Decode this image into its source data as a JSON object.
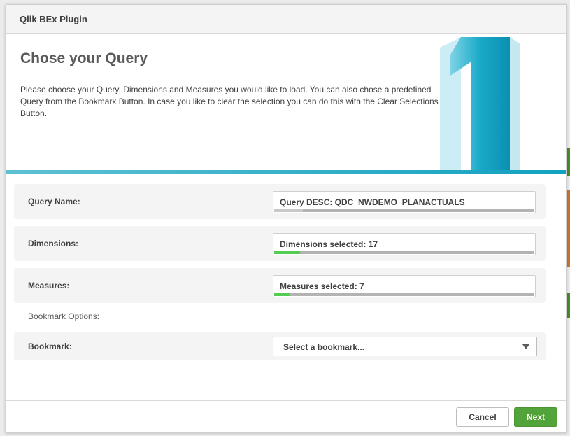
{
  "dialog": {
    "title": "Qlik BEx Plugin"
  },
  "hero": {
    "heading": "Chose your Query",
    "description": "Please choose your Query, Dimensions and Measures you would like to load. You can also chose a predefined Query from the Bookmark Button. In case you like to clear the selection you can do this with the Clear Selections Button.",
    "step_number": "1"
  },
  "rows": {
    "query": {
      "label": "Query Name:",
      "value": "Query DESC: QDC_NWDEMO_PLANACTUALS",
      "progress": 0.11
    },
    "dimensions": {
      "label": "Dimensions:",
      "value": "Dimensions selected: 17",
      "progress": 0.1
    },
    "measures": {
      "label": "Measures:",
      "value": "Measures selected: 7",
      "progress": 0.06
    }
  },
  "bookmark_options_label": "Bookmark Options:",
  "bookmark": {
    "label": "Bookmark:",
    "selected": "Select a bookmark..."
  },
  "footer": {
    "cancel_label": "Cancel",
    "next_label": "Next"
  },
  "colors": {
    "accent_green": "#52a339",
    "progress_green": "#52cc52",
    "hero_blue": "#11a2c0"
  }
}
